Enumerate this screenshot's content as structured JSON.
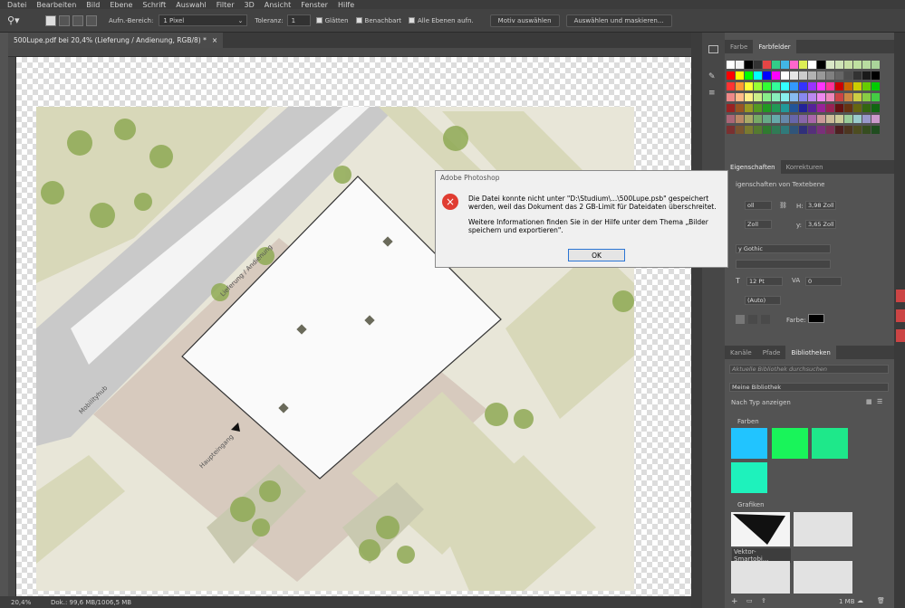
{
  "menu": [
    "Datei",
    "Bearbeiten",
    "Bild",
    "Ebene",
    "Schrift",
    "Auswahl",
    "Filter",
    "3D",
    "Ansicht",
    "Fenster",
    "Hilfe"
  ],
  "options": {
    "sample_label": "Aufn.-Bereich:",
    "sample_value": "1 Pixel",
    "tolerance_label": "Toleranz:",
    "tolerance_value": "1",
    "smooth_label": "Glätten",
    "contiguous_label": "Benachbart",
    "all_layers_label": "Alle Ebenen aufn.",
    "subject_button": "Motiv auswählen",
    "select_mask_button": "Auswählen und maskieren..."
  },
  "document": {
    "tab_title": "500Lupe.pdf bei 20,4% (Lieferung / Andienung, RGB/8) *",
    "close": "×"
  },
  "status": {
    "zoom": "20,4%",
    "doc_info": "Dok.: 99,6 MB/1006,5 MB"
  },
  "plan_labels": {
    "lieferung": "Lieferung / Andienung",
    "mobility": "Mobilityhub",
    "haupteingang": "Haupteingang"
  },
  "dialog": {
    "title": "Adobe Photoshop",
    "message1": "Die Datei konnte nicht unter \"D:\\Studium\\...\\500Lupe.psb\" gespeichert werden, weil das Dokument das 2 GB-Limit für Dateidaten überschreitet.",
    "message2": "Weitere Informationen finden Sie in der Hilfe unter dem Thema „Bilder speichern und exportieren\".",
    "ok_button": "OK"
  },
  "swatches_panel": {
    "tab_farbe": "Farbe",
    "tab_farbfelder": "Farbfelder"
  },
  "properties_panel": {
    "tab_eigenschaften": "Eigenschaften",
    "tab_korrekturen": "Korrekturen",
    "section": "igenschaften von Textebene",
    "w_value": "oll",
    "h_label": "H:",
    "h_value": "3,98 Zoll",
    "x_value": "Zoll",
    "y_label": "y:",
    "y_value": "3,65 Zoll",
    "font_family": "y Gothic",
    "font_size": "12 Pt",
    "tracking": "0",
    "leading": "(Auto)",
    "color_label": "Farbe:"
  },
  "libraries_panel": {
    "tab_kanaele": "Kanäle",
    "tab_pfade": "Pfade",
    "tab_bibliotheken": "Bibliotheken",
    "search_placeholder": "Aktuelle Bibliothek durchsuchen",
    "library_name": "Meine Bibliothek",
    "view_mode": "Nach Typ anzeigen",
    "colors_header": "Farben",
    "graphics_header": "Grafiken",
    "graphic1_label": "Vektor-Smartobj...",
    "storage": "1 MB",
    "library_colors": [
      "#21c4ff",
      "#19f45a",
      "#1ee88a",
      "#1ef2bc"
    ]
  },
  "colors": {
    "dialog_error": "#e03c31",
    "ok_border": "#2b75d4"
  },
  "icons": {
    "error": "error-icon",
    "chevron": "chevron-down-icon"
  }
}
